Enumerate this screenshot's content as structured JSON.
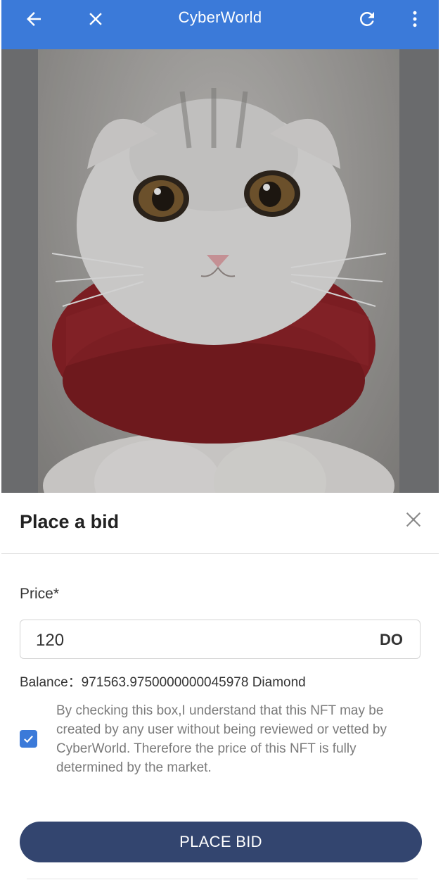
{
  "app": {
    "title": "CyberWorld",
    "bar_color": "#3b7ad9"
  },
  "toolbar": {
    "back_icon": "arrow-left-icon",
    "close_icon": "close-icon",
    "reload_icon": "refresh-icon",
    "menu_icon": "more-vert-icon"
  },
  "nft": {
    "image": "white cat wearing red knitted scarf"
  },
  "bid_sheet": {
    "title": "Place a bid",
    "price_label": "Price*",
    "price_value": "120",
    "currency": "DO",
    "balance": "Balance：971563.9750000000045978 Diamond",
    "disclaimer": "By checking this box,I understand that this NFT may be created by any user without being reviewed or vetted by CyberWorld. Therefore the price of this NFT is fully determined by the market.",
    "agreed": true,
    "button_label": "PLACE BID",
    "button_color": "#33456f"
  }
}
